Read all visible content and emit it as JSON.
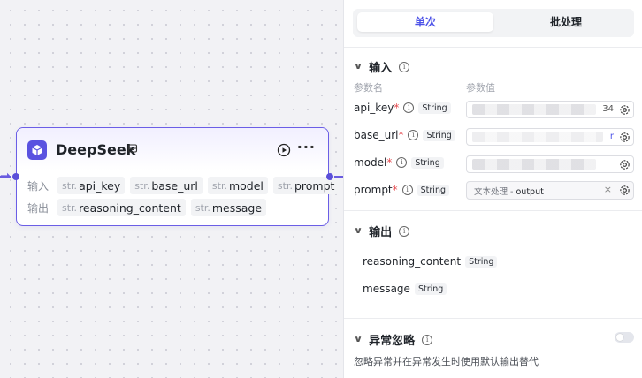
{
  "node": {
    "title": "DeepSeek",
    "input_label": "输入",
    "output_label": "输出",
    "type_prefix": "str.",
    "inputs": [
      "api_key",
      "base_url",
      "model",
      "prompt"
    ],
    "outputs": [
      "reasoning_content",
      "message"
    ]
  },
  "panel": {
    "tabs": {
      "single": "单次",
      "batch": "批处理"
    },
    "input_section": {
      "title": "输入",
      "col_name": "参数名",
      "col_value": "参数值",
      "params": [
        {
          "name": "api_key",
          "required": "*",
          "type": "String",
          "tail": "34"
        },
        {
          "name": "base_url",
          "required": "*",
          "type": "String",
          "tail": "r"
        },
        {
          "name": "model",
          "required": "*",
          "type": "String"
        },
        {
          "name": "prompt",
          "required": "*",
          "type": "String",
          "ref_source": "文本处理",
          "ref_sep": " - ",
          "ref_field": "output",
          "clear": "×"
        }
      ]
    },
    "output_section": {
      "title": "输出",
      "items": [
        {
          "name": "reasoning_content",
          "type": "String"
        },
        {
          "name": "message",
          "type": "String"
        }
      ]
    },
    "error_section": {
      "title": "异常忽略",
      "enabled": false,
      "description": "忽略异常并在异常发生时使用默认输出替代"
    }
  },
  "colors": {
    "accent": "#4d53e8",
    "node_border": "#6b5ee6",
    "required": "#e5484d"
  },
  "icons": [
    "deepseek-logo-icon",
    "badge-icon",
    "run-icon",
    "more-icon",
    "chevron-down-icon",
    "info-icon",
    "gear-icon",
    "clear-icon"
  ]
}
